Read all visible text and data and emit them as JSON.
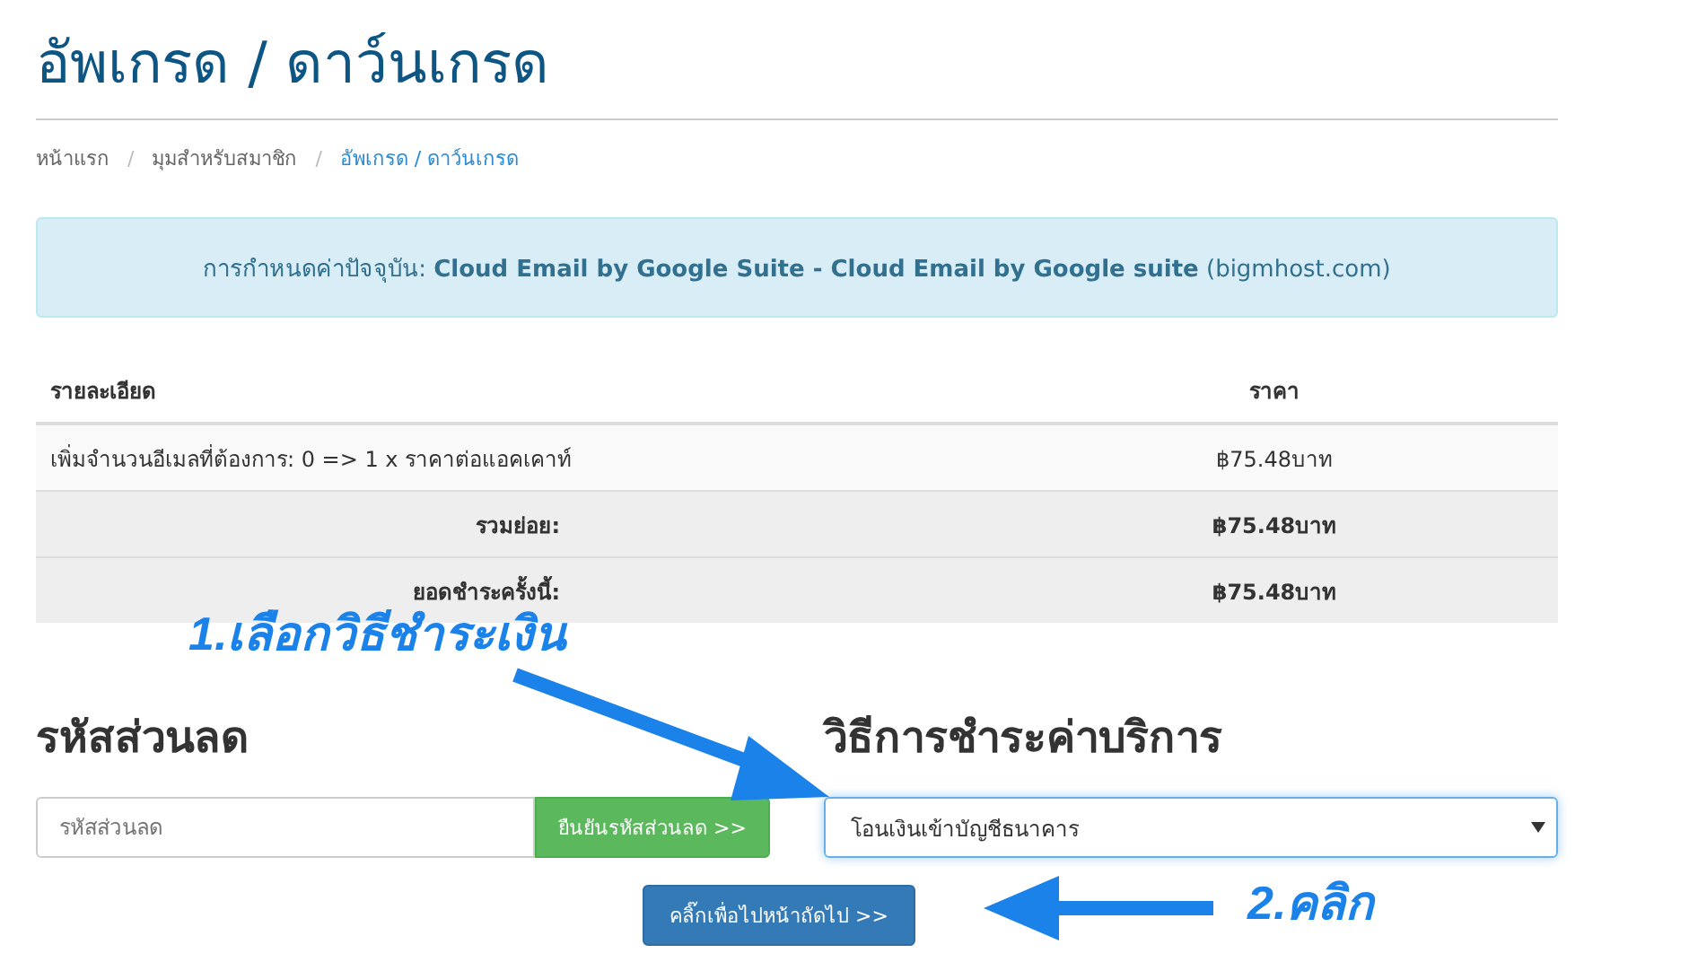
{
  "page_title": "อัพเกรด / ดาว์นเกรด",
  "breadcrumb": [
    {
      "label": "หน้าแรก",
      "selected": false
    },
    {
      "separator": "/",
      "label": "มุมสำหรับสมาชิก",
      "selected": false
    },
    {
      "separator": "/",
      "label": "อัพเกรด / ดาว์นเกรด",
      "selected": true
    }
  ],
  "alert": "การกำหนดค่าปัจจุบัน: **Cloud Email by Google Suite - Cloud Email by Google suite** (bigmhost.com)",
  "table": {
    "columns": [
      "รายละเอียด",
      "ราคา"
    ],
    "rows": [
      {
        "kind": "item",
        "label": "เพิ่มจำนวนอีเมลที่ต้องการ: 0 => 1 x ราคาต่อแอคเคาท์",
        "price": "฿75.48บาท"
      },
      {
        "kind": "total",
        "label": "รวมย่อย:",
        "price": "฿75.48บาท"
      },
      {
        "kind": "total",
        "label": "ยอดชำระครั้งนี้:",
        "price": "฿75.48บาท"
      }
    ]
  },
  "promo": {
    "heading": "รหัสส่วนลด",
    "placeholder": "รหัสส่วนลด",
    "button": "ยืนยันรหัสส่วนลด >>"
  },
  "payment": {
    "heading": "วิธีการชำระค่าบริการ",
    "value": "โอนเงินเข้าบัญชีธนาคาร"
  },
  "next_button": "คลิ๊กเพื่อไปหน้าถัดไป >>",
  "annotations": [
    "1.เลือกวิธีชำระเงิน",
    "2.คลิก"
  ]
}
